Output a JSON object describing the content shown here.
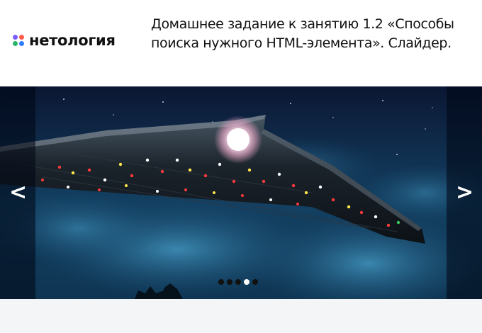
{
  "header": {
    "logo_text": "нетология",
    "title": "Домашнее задание к занятию 1.2 «Способы поиска нужного HTML-элемента». Слайдер."
  },
  "slider": {
    "prev_label": "<",
    "next_label": ">",
    "slide_count": 5,
    "active_index": 3,
    "current_image": "night-sky-spaceship"
  },
  "colors": {
    "logo_dot_1": "#7b5cff",
    "logo_dot_2": "#ff5b4a",
    "logo_dot_3": "#29b36a",
    "logo_dot_4": "#2f7bff",
    "dot_inactive": "#111111",
    "dot_active": "#ffffff"
  }
}
